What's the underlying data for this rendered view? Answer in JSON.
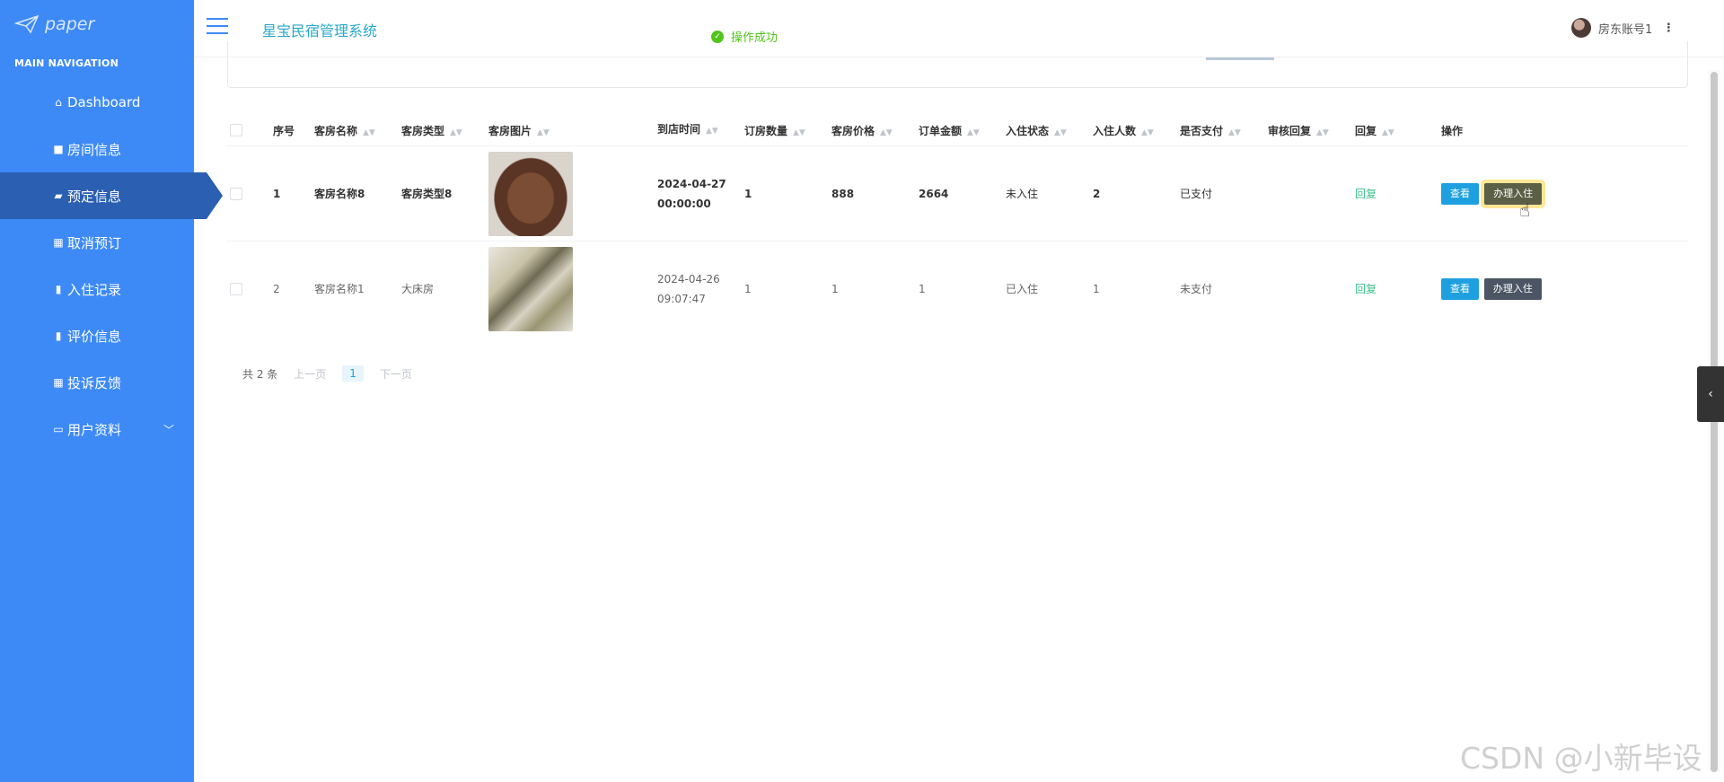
{
  "app": {
    "logo_text": "paper",
    "title": "星宝民宿管理系统"
  },
  "sidebar": {
    "heading": "MAIN NAVIGATION",
    "items": [
      {
        "label": "Dashboard",
        "icon": "home-icon"
      },
      {
        "label": "房间信息",
        "icon": "monitor-icon"
      },
      {
        "label": "预定信息",
        "icon": "briefcase-icon",
        "active": true
      },
      {
        "label": "取消预订",
        "icon": "grid-icon"
      },
      {
        "label": "入住记录",
        "icon": "clipboard-icon"
      },
      {
        "label": "评价信息",
        "icon": "book-icon"
      },
      {
        "label": "投诉反馈",
        "icon": "grid-icon"
      },
      {
        "label": "用户资料",
        "icon": "id-card-icon",
        "expandable": true
      }
    ]
  },
  "toast": {
    "message": "操作成功"
  },
  "user": {
    "name": "房东账号1"
  },
  "table": {
    "headers": [
      "序号",
      "客房名称",
      "客房类型",
      "客房图片",
      "到店时间",
      "订房数量",
      "客房价格",
      "订单金额",
      "入住状态",
      "入住人数",
      "是否支付",
      "审核回复",
      "回复",
      "操作"
    ],
    "rows": [
      {
        "idx": "1",
        "name": "客房名称8",
        "type": "客房类型8",
        "time": "2024-04-27 00:00:00",
        "qty": "1",
        "price": "888",
        "amount": "2664",
        "state": "未入住",
        "people": "2",
        "paid": "已支付",
        "audit": "",
        "reply": "回复"
      },
      {
        "idx": "2",
        "name": "客房名称1",
        "type": "大床房",
        "time": "2024-04-26 09:07:47",
        "qty": "1",
        "price": "1",
        "amount": "1",
        "state": "已入住",
        "people": "1",
        "paid": "未支付",
        "audit": "",
        "reply": "回复"
      }
    ],
    "actions": {
      "view": "查看",
      "checkin": "办理入住"
    }
  },
  "pagination": {
    "total": "共 2 条",
    "prev": "上一页",
    "current": "1",
    "next": "下一页"
  },
  "watermark": "CSDN @小新毕设",
  "colors": {
    "sidebar": "#3d8af7",
    "sidebar_active": "#2b5fb2",
    "title": "#2aa8c7",
    "success": "#52c41a",
    "view_button": "#1ea0e0",
    "checkin_button": "#4b5563",
    "reply_link": "#3cc08b"
  }
}
